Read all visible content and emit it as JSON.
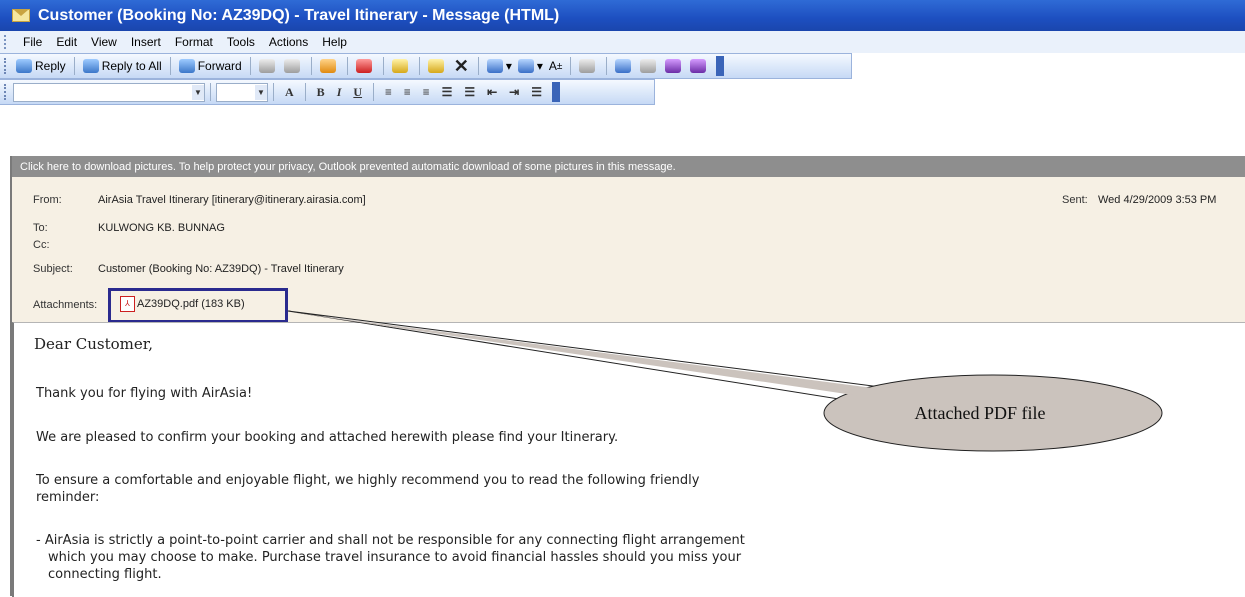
{
  "window": {
    "title": "Customer (Booking No: AZ39DQ) - Travel Itinerary - Message (HTML)"
  },
  "menu": [
    "File",
    "Edit",
    "View",
    "Insert",
    "Format",
    "Tools",
    "Actions",
    "Help"
  ],
  "toolbar": {
    "reply": "Reply",
    "reply_all": "Reply to All",
    "forward": "Forward"
  },
  "infobar": {
    "text": "Click here to download pictures. To help protect your privacy, Outlook prevented automatic download of some pictures in this message."
  },
  "header": {
    "from_label": "From:",
    "from_value": "AirAsia Travel Itinerary [itinerary@itinerary.airasia.com]",
    "sent_label": "Sent:",
    "sent_value": "Wed 4/29/2009 3:53 PM",
    "to_label": "To:",
    "to_value": "KULWONG KB. BUNNAG",
    "cc_label": "Cc:",
    "subject_label": "Subject:",
    "subject_value": "Customer (Booking No: AZ39DQ) - Travel Itinerary",
    "attachment_label": "Attachments:",
    "attachment_file": "AZ39DQ.pdf (183 KB)"
  },
  "body": {
    "greeting": "Dear Customer,",
    "p1": "Thank you for flying with AirAsia!",
    "p2": "We are pleased to confirm your booking and attached herewith please find your Itinerary.",
    "p3_line1": "To ensure a comfortable and enjoyable flight, we highly recommend you to read the following friendly",
    "p3_line2": "reminder:",
    "bullet_line1": "- AirAsia is strictly a point-to-point carrier and shall not be responsible for any connecting flight arrangement",
    "bullet_line2": "which you may choose to make. Purchase travel insurance to avoid financial hassles should you miss your",
    "bullet_line3": "connecting flight."
  },
  "callout": {
    "text": "Attached PDF file"
  }
}
